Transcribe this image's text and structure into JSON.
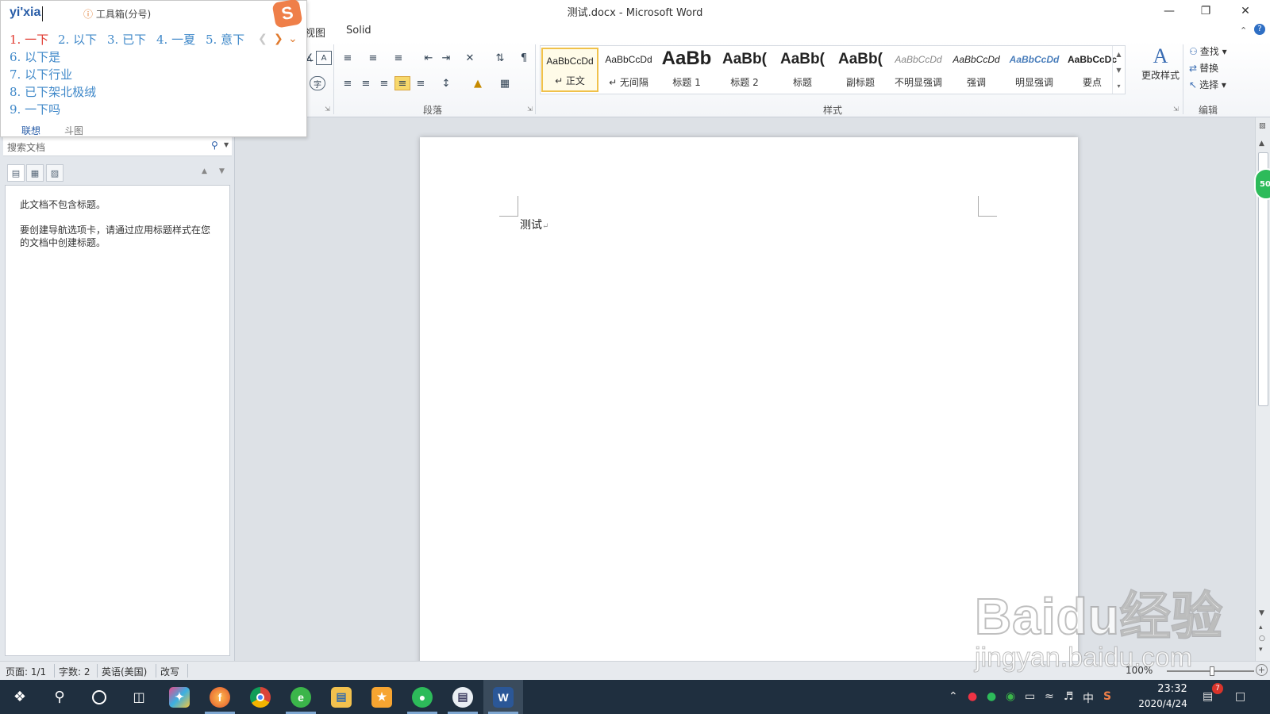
{
  "window": {
    "title": "测试.docx - Microsoft Word",
    "minimize_icon": "minimize-icon",
    "restore_icon": "restore-icon",
    "close_icon": "close-icon"
  },
  "ribbon_tabs": [
    "视图",
    "Solid"
  ],
  "ribbon": {
    "group_paragraph": "段落",
    "group_styles": "样式",
    "group_editing": "编辑",
    "styles": [
      {
        "sample": "AaBbCcDd",
        "name": "↵ 正文",
        "selected": true
      },
      {
        "sample": "AaBbCcDd",
        "name": "↵ 无间隔"
      },
      {
        "sample": "AaBb",
        "name": "标题 1"
      },
      {
        "sample": "AaBb(",
        "name": "标题 2"
      },
      {
        "sample": "AaBb(",
        "name": "标题"
      },
      {
        "sample": "AaBb(",
        "name": "副标题"
      },
      {
        "sample": "AaBbCcDd",
        "name": "不明显强调"
      },
      {
        "sample": "AaBbCcDd",
        "name": "强调"
      },
      {
        "sample": "AaBbCcDd",
        "name": "明显强调"
      },
      {
        "sample": "AaBbCcDc",
        "name": "要点"
      }
    ],
    "change_styles": "更改样式",
    "find": "查找",
    "replace": "替换",
    "select": "选择"
  },
  "ime": {
    "pinyin": "yi'xia",
    "toolbox": "工具箱(分号)",
    "logo": "S",
    "candidates": [
      "1. 一下",
      "2. 以下",
      "3. 已下",
      "4. 一夏",
      "5. 意下",
      "6. 以下是",
      "7. 以下行业",
      "8. 已下架北极绒",
      "9. 一下吗"
    ],
    "tab_lianxiang": "联想",
    "tab_doutu": "斗图"
  },
  "nav_pane": {
    "search_placeholder": "搜索文档",
    "msg_no_headings": "此文档不包含标题。",
    "msg_instructions": "要创建导航选项卡，请通过应用标题样式在您的文档中创建标题。"
  },
  "document": {
    "text": "测试",
    "para_mark": "↵"
  },
  "status_bar": {
    "page": "页面: 1/1",
    "words": "字数: 2",
    "language": "英语(美国)",
    "mode": "改写",
    "zoom": "100%"
  },
  "badge": "50",
  "taskbar": {
    "time": "23:32",
    "date": "2020/4/24",
    "ime_mode": "中",
    "notifications": "7"
  },
  "watermark": {
    "brand": "Baidu经验",
    "url": "jingyan.baidu.com"
  }
}
